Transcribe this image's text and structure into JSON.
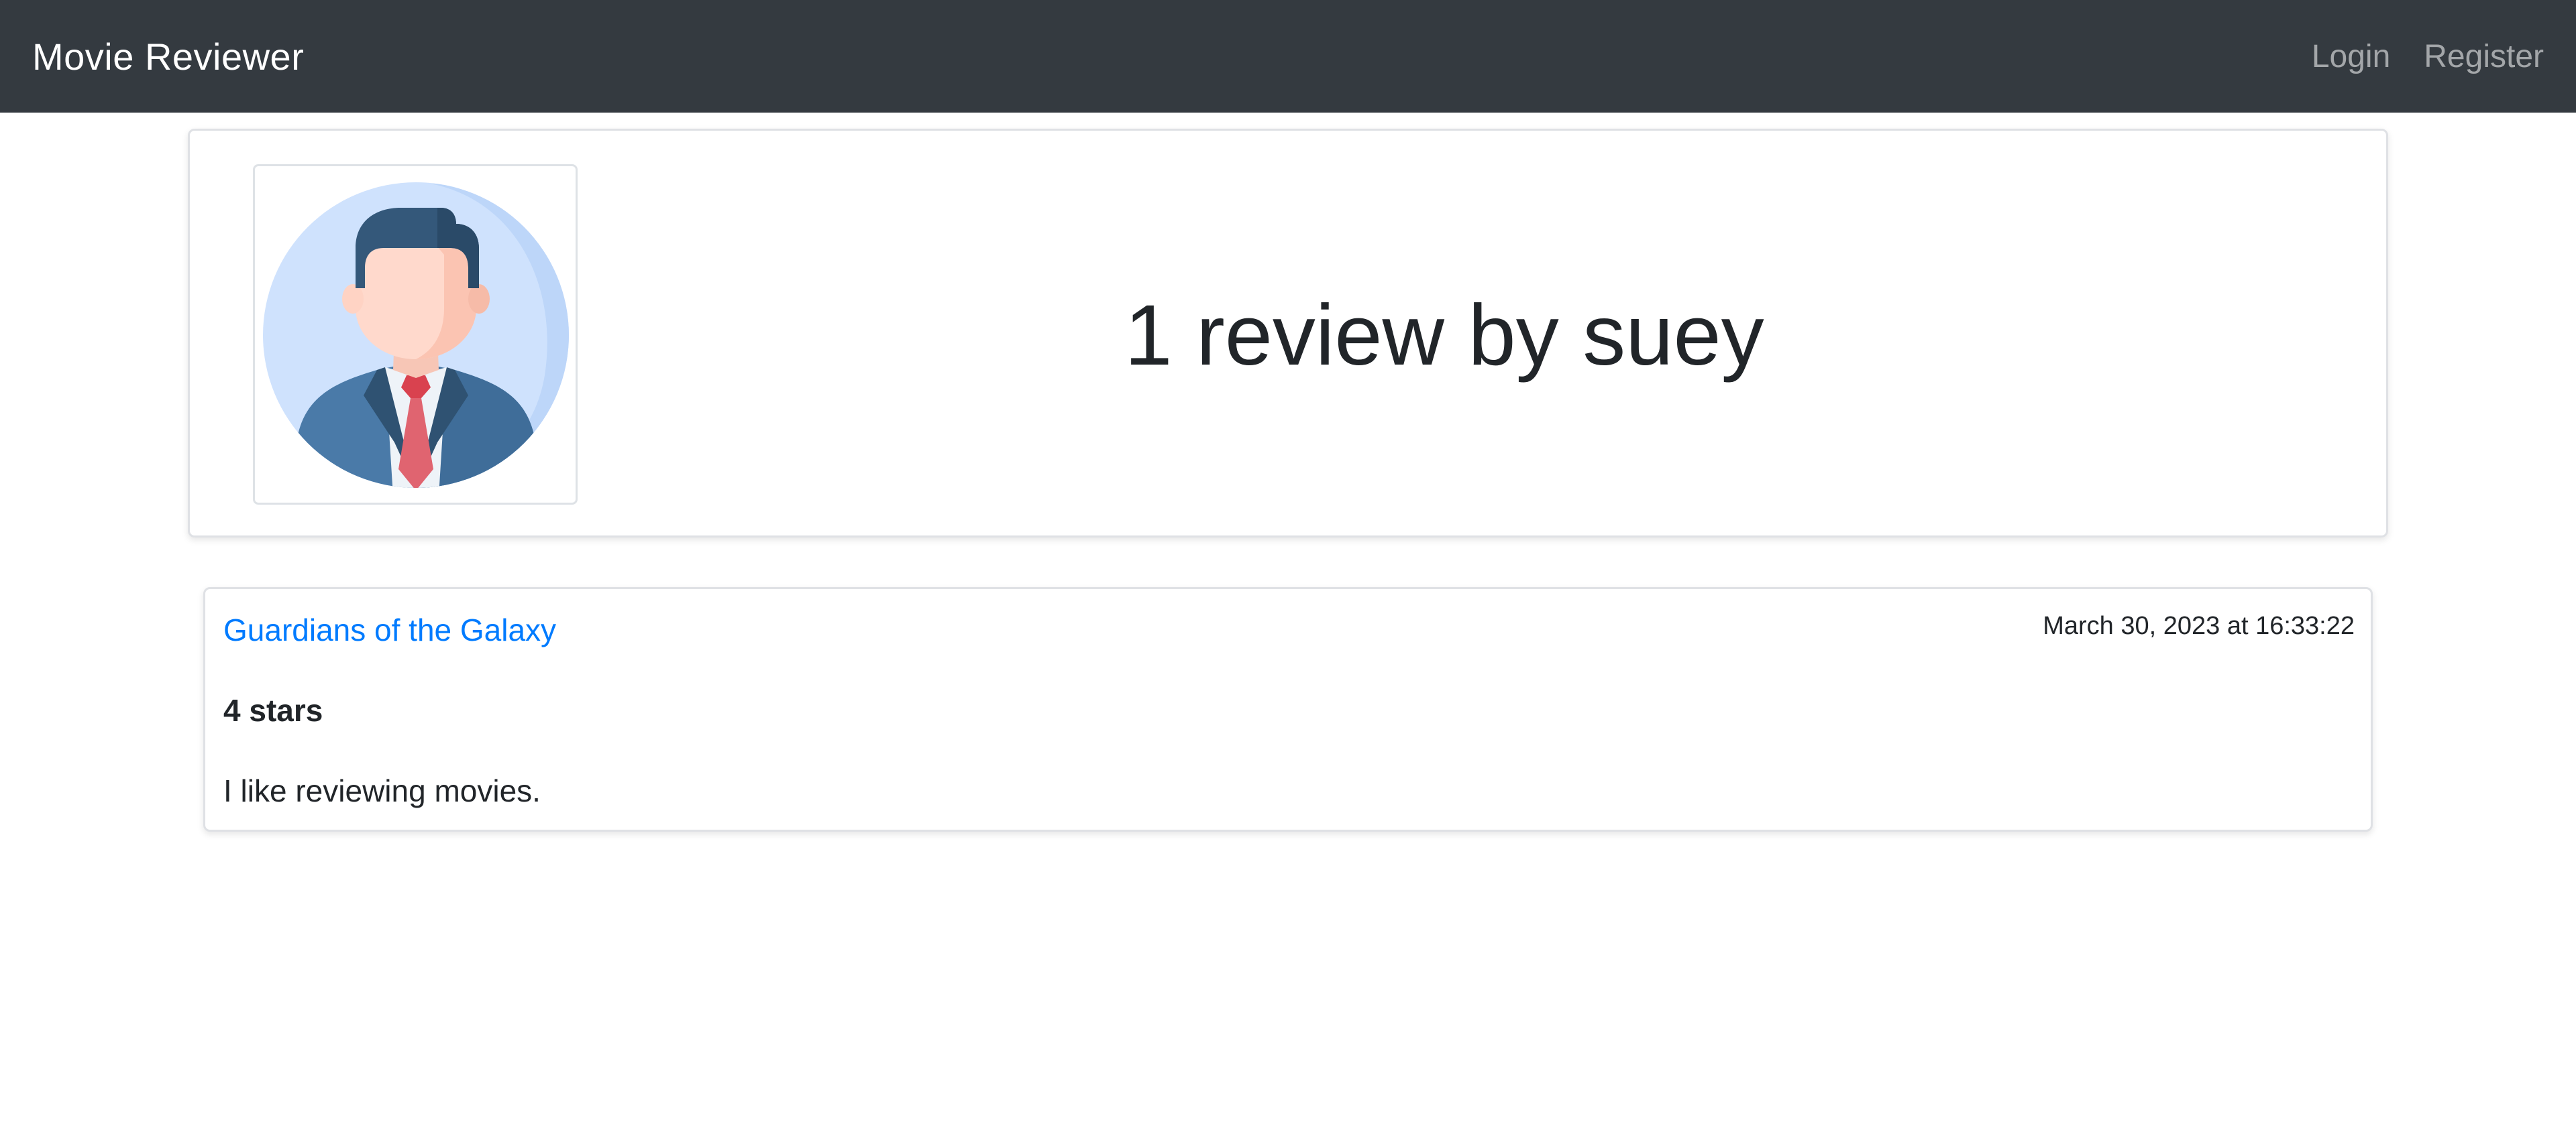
{
  "navbar": {
    "brand": "Movie Reviewer",
    "links": [
      {
        "label": "Login"
      },
      {
        "label": "Register"
      }
    ],
    "bg_color": "#343a40"
  },
  "profile": {
    "avatar_icon": "businessman-avatar-icon",
    "heading": "1 review by suey"
  },
  "reviews": [
    {
      "movie_title": "Guardians of the Galaxy",
      "date": "March 30, 2023 at 16:33:22",
      "rating_text": "4 stars",
      "body": "I like reviewing movies."
    }
  ],
  "colors": {
    "link": "#007bff",
    "text": "#212529"
  }
}
